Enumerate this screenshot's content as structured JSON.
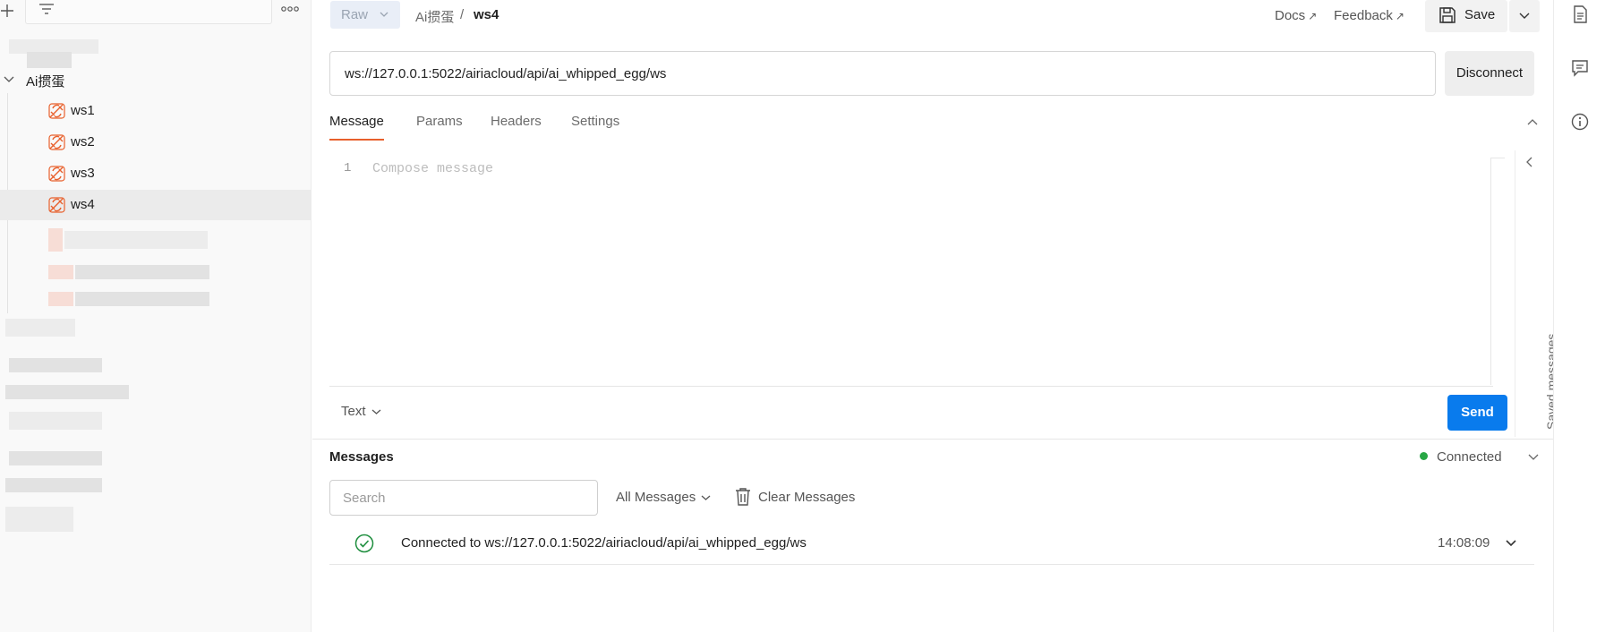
{
  "sidebar": {
    "folder_label": "Ai掼蛋",
    "items": [
      {
        "label": "ws1"
      },
      {
        "label": "ws2"
      },
      {
        "label": "ws3"
      },
      {
        "label": "ws4"
      }
    ]
  },
  "header": {
    "mode_label": "Raw",
    "breadcrumb_parent": "Ai掼蛋",
    "breadcrumb_separator": "/",
    "breadcrumb_current": "ws4",
    "docs_label": "Docs",
    "feedback_label": "Feedback",
    "link_arrow": "↗",
    "save_label": "Save"
  },
  "request": {
    "url": "ws://127.0.0.1:5022/airiacloud/api/ai_whipped_egg/ws",
    "disconnect_label": "Disconnect"
  },
  "tabs": [
    {
      "label": "Message"
    },
    {
      "label": "Params"
    },
    {
      "label": "Headers"
    },
    {
      "label": "Settings"
    }
  ],
  "editor": {
    "line_number": "1",
    "placeholder": "Compose message",
    "format_label": "Text",
    "send_label": "Send",
    "saved_messages_label": "Saved messages"
  },
  "messages": {
    "title": "Messages",
    "status": "Connected",
    "search_placeholder": "Search",
    "filter_label": "All Messages",
    "clear_label": "Clear Messages",
    "rows": [
      {
        "text": "Connected to ws://127.0.0.1:5022/airiacloud/api/ai_whipped_egg/ws",
        "time": "14:08:09"
      }
    ]
  },
  "colors": {
    "accent": "#e8602c",
    "send": "#097bed",
    "connected": "#28a745"
  }
}
